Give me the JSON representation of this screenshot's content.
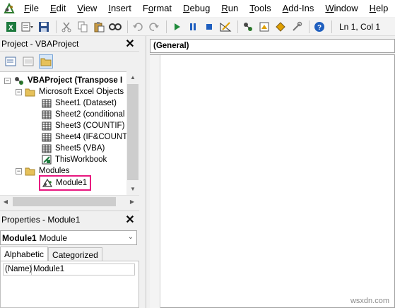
{
  "menubar": {
    "items": [
      {
        "label": "File",
        "u": "F"
      },
      {
        "label": "Edit",
        "u": "E"
      },
      {
        "label": "View",
        "u": "V"
      },
      {
        "label": "Insert",
        "u": "I"
      },
      {
        "label": "Format",
        "u": "o"
      },
      {
        "label": "Debug",
        "u": "D"
      },
      {
        "label": "Run",
        "u": "R"
      },
      {
        "label": "Tools",
        "u": "T"
      },
      {
        "label": "Add-Ins",
        "u": "A"
      },
      {
        "label": "Window",
        "u": "W"
      },
      {
        "label": "Help",
        "u": "H"
      }
    ]
  },
  "toolbar": {
    "status": "Ln 1, Col 1",
    "icons": [
      "excel-icon",
      "insert-module-icon",
      "save-icon",
      "cut-icon",
      "copy-icon",
      "paste-icon",
      "find-icon",
      "undo-icon",
      "redo-icon",
      "run-icon",
      "break-icon",
      "reset-icon",
      "design-mode-icon",
      "project-explorer-icon",
      "properties-icon",
      "object-browser-icon",
      "toolbox-icon",
      "help-icon"
    ]
  },
  "project": {
    "title": "Project - VBAProject",
    "tree": {
      "root": "VBAProject (Transpose I",
      "excel_objects": "Microsoft Excel Objects",
      "sheets": [
        "Sheet1 (Dataset)",
        "Sheet2 (conditional f",
        "Sheet3 (COUNTIF)",
        "Sheet4 (IF&COUNTI",
        "Sheet5 (VBA)"
      ],
      "workbook": "ThisWorkbook",
      "modules": "Modules",
      "module1": "Module1"
    }
  },
  "properties": {
    "title": "Properties - Module1",
    "object_name": "Module1",
    "object_type": "Module",
    "tabs": [
      "Alphabetic",
      "Categorized"
    ],
    "row_name": "(Name)",
    "row_value": "Module1"
  },
  "code": {
    "general": "(General)"
  },
  "watermark": "wsxdn.com",
  "colors": {
    "highlight": "#e8177f",
    "accent": "#1f5fbf"
  }
}
